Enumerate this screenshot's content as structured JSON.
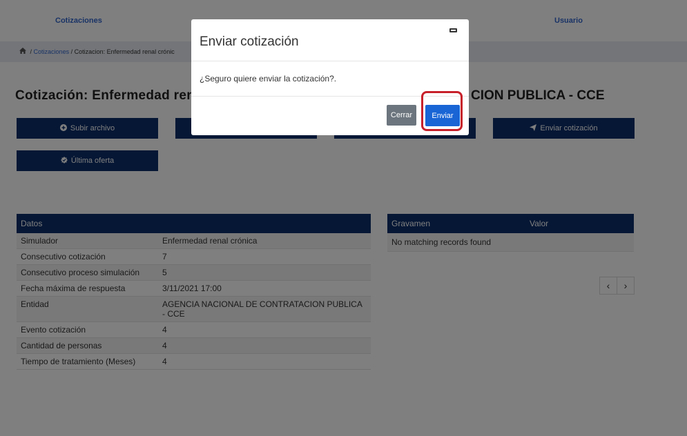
{
  "nav": {
    "cotizaciones": "Cotizaciones",
    "usuario": "Usuario"
  },
  "breadcrumb": {
    "home_icon": "home-icon",
    "link": "Cotizaciones",
    "sep": "/",
    "current": "Cotizacion: Enfermedad renal crónic"
  },
  "page": {
    "title_head": "Cotización: Enfermedad rena",
    "title_tail": "CION PUBLICA - CCE"
  },
  "actions": {
    "subir_archivo": "Subir archivo",
    "subir_icon": "plus-circle-icon",
    "enviar_cotizacion": "Enviar cotización",
    "enviar_icon": "paper-plane-icon",
    "ultima_oferta": "Última oferta",
    "ultima_icon": "check-badge-icon"
  },
  "datos": {
    "header": "Datos",
    "rows": [
      {
        "label": "Simulador",
        "value": "Enfermedad renal crónica"
      },
      {
        "label": "Consecutivo cotización",
        "value": "7"
      },
      {
        "label": "Consecutivo proceso simulación",
        "value": "5"
      },
      {
        "label": "Fecha máxima de respuesta",
        "value": "3/11/2021 17:00"
      },
      {
        "label": "Entidad",
        "value": "AGENCIA NACIONAL DE CONTRATACION PUBLICA - CCE"
      },
      {
        "label": "Evento cotización",
        "value": "4"
      },
      {
        "label": "Cantidad de personas",
        "value": "4"
      },
      {
        "label": "Tiempo de tratamiento (Meses)",
        "value": "4"
      }
    ]
  },
  "gravamen": {
    "col_gravamen": "Gravamen",
    "col_valor": "Valor",
    "empty": "No matching records found",
    "prev": "‹",
    "next": "›"
  },
  "modal": {
    "title": "Enviar cotización",
    "message": "¿Seguro quiere enviar la cotización?.",
    "close_label": "Cerrar",
    "send_label": "Enviar"
  },
  "colors": {
    "navy": "#0b2f6a",
    "primary": "#1a65d6",
    "highlight": "#c8202a"
  }
}
